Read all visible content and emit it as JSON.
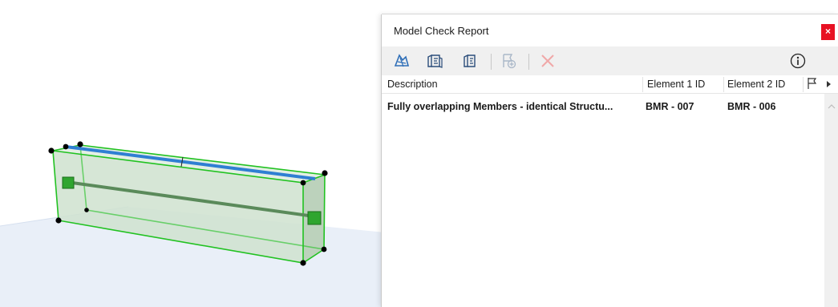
{
  "dialog": {
    "title": "Model Check Report",
    "close_label": "×"
  },
  "toolbar": {
    "buttons": [
      {
        "icon": "show-in-model-icon",
        "enabled": true
      },
      {
        "icon": "select-element-1-icon",
        "enabled": true
      },
      {
        "icon": "select-element-2-icon",
        "enabled": true
      },
      {
        "icon": "mark-solved-icon",
        "enabled": false
      },
      {
        "icon": "delete-icon",
        "enabled": false
      },
      {
        "icon": "info-icon",
        "enabled": true
      }
    ]
  },
  "table": {
    "columns": [
      "Description",
      "Element 1 ID",
      "Element 2 ID"
    ],
    "flag_column_icon": "flag-icon",
    "rows": [
      {
        "description": "Fully overlapping Members - identical Structu...",
        "element1": "BMR - 007",
        "element2": "BMR - 006"
      }
    ]
  },
  "colors": {
    "accent_blue": "#2f7fd3",
    "selection_green": "#22c222",
    "delete_red": "#f0a8a8",
    "close_red": "#e81123",
    "toolbar_bg": "#f0f0f0"
  }
}
